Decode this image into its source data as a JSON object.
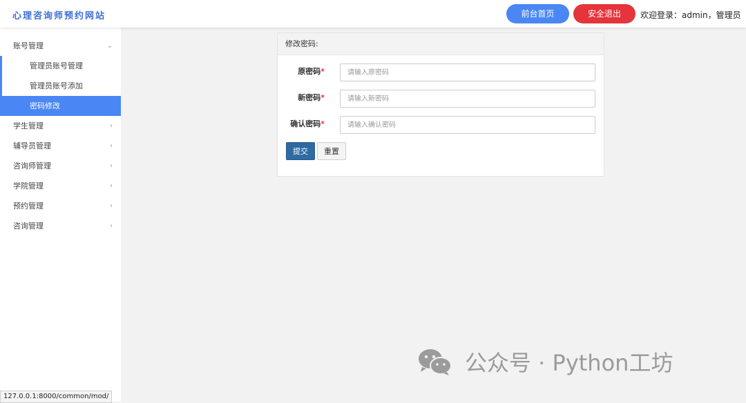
{
  "header": {
    "brand": "心理咨询师预约网站",
    "home_button": "前台首页",
    "logout_button": "安全退出",
    "welcome": "欢迎登录：admin，管理员"
  },
  "sidebar": {
    "groups": [
      {
        "label": "账号管理",
        "expanded": true,
        "items": [
          {
            "label": "管理员账号管理"
          },
          {
            "label": "管理员账号添加"
          },
          {
            "label": "密码修改",
            "active": true
          }
        ]
      },
      {
        "label": "学生管理"
      },
      {
        "label": "辅导员管理"
      },
      {
        "label": "咨询师管理"
      },
      {
        "label": "学院管理"
      },
      {
        "label": "预约管理"
      },
      {
        "label": "咨询管理"
      }
    ],
    "chevron_expanded": "⌄",
    "chevron_collapsed": "‹"
  },
  "panel": {
    "title": "修改密码:",
    "fields": [
      {
        "label": "原密码",
        "required_mark": "*",
        "placeholder": "请输入原密码",
        "value": ""
      },
      {
        "label": "新密码",
        "required_mark": "*",
        "placeholder": "请输入新密码",
        "value": ""
      },
      {
        "label": "确认密码",
        "required_mark": "*",
        "placeholder": "请输入确认密码",
        "value": ""
      }
    ],
    "submit_button": "提交",
    "reset_button": "重置"
  },
  "watermark": {
    "text": "公众号 · Python工坊"
  },
  "status_bar": {
    "url": "127.0.0.1:8000/common/mod/"
  },
  "colors": {
    "accent": "#4a87f4",
    "danger": "#e5343c",
    "submit": "#2f6aa3",
    "brand_text": "#3d6fd8"
  }
}
